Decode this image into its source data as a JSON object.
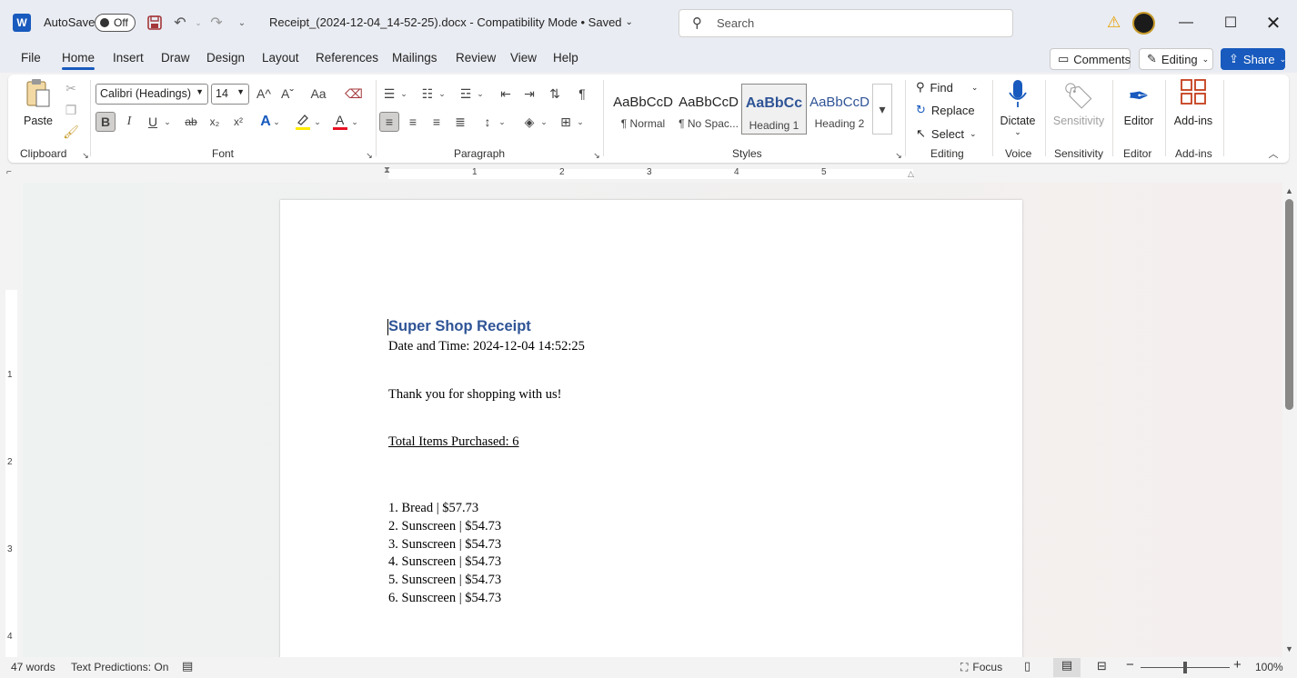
{
  "titlebar": {
    "app_logo": "W",
    "autosave_label": "AutoSave",
    "autosave_state": "Off",
    "doc_title": "Receipt_(2024-12-04_14-52-25).docx  -  Compatibility Mode  •  Saved",
    "search_placeholder": "Search"
  },
  "tabs": [
    "File",
    "Home",
    "Insert",
    "Draw",
    "Design",
    "Layout",
    "References",
    "Mailings",
    "Review",
    "View",
    "Help"
  ],
  "right_buttons": {
    "comments": "Comments",
    "editing": "Editing",
    "share": "Share"
  },
  "ribbon": {
    "clipboard": {
      "paste": "Paste",
      "label": "Clipboard"
    },
    "font": {
      "family": "Calibri (Headings)",
      "size": "14",
      "label": "Font",
      "bold": "B",
      "italic": "I",
      "underline": "U",
      "strike": "ab",
      "subscript": "x₂",
      "superscript": "x²",
      "font_color_letter": "A",
      "grow": "A^",
      "shrink": "Aˇ",
      "case": "Aa"
    },
    "paragraph": {
      "label": "Paragraph",
      "pilcrow": "¶"
    },
    "styles": {
      "label": "Styles",
      "items": [
        {
          "preview": "AaBbCcD",
          "name": "¶ Normal"
        },
        {
          "preview": "AaBbCcD",
          "name": "¶ No Spac..."
        },
        {
          "preview": "AaBbCc",
          "name": "Heading 1"
        },
        {
          "preview": "AaBbCcD",
          "name": "Heading 2"
        }
      ]
    },
    "editing": {
      "find": "Find",
      "replace": "Replace",
      "select": "Select",
      "label": "Editing"
    },
    "voice": {
      "dictate": "Dictate",
      "label": "Voice"
    },
    "sensitivity": {
      "button": "Sensitivity",
      "label": "Sensitivity"
    },
    "editor": {
      "button": "Editor",
      "label": "Editor"
    },
    "addins": {
      "button": "Add-ins",
      "label": "Add-ins"
    }
  },
  "ruler": {
    "numbers": [
      "1",
      "2",
      "3",
      "4",
      "5"
    ],
    "vnumbers": [
      "1",
      "2",
      "3",
      "4"
    ]
  },
  "document": {
    "heading": "Super Shop Receipt",
    "datetime": "Date and Time: 2024-12-04 14:52:25",
    "thanks": "Thank you for shopping with us!",
    "total": "Total Items Purchased: 6",
    "items": [
      "1. Bread | $57.73",
      "2. Sunscreen | $54.73",
      "3. Sunscreen | $54.73",
      "4. Sunscreen | $54.73",
      "5. Sunscreen | $54.73",
      "6. Sunscreen | $54.73"
    ]
  },
  "statusbar": {
    "words": "47 words",
    "predictions": "Text Predictions: On",
    "focus": "Focus",
    "zoom": "100%"
  },
  "colors": {
    "accent": "#185abd",
    "heading": "#2f5496",
    "font_color_bar": "#e81123",
    "highlight_bar": "#ffeb00"
  }
}
